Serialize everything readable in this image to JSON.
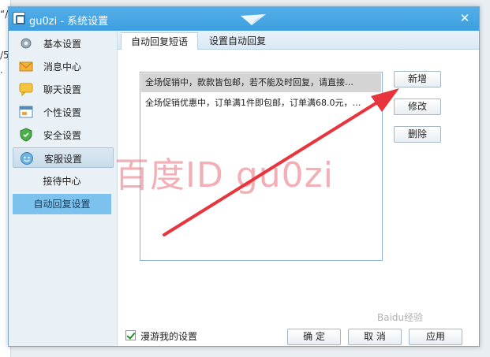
{
  "background": {
    "left_fragments": [
      "“/0",
      "/5",
      "·"
    ]
  },
  "window": {
    "title": "gu0zi - 系统设置",
    "close_glyph": "✕"
  },
  "sidebar": {
    "items": [
      {
        "label": "基本设置",
        "icon": "gear-icon"
      },
      {
        "label": "消息中心",
        "icon": "envelope-icon"
      },
      {
        "label": "聊天设置",
        "icon": "chat-bubble-icon"
      },
      {
        "label": "个性设置",
        "icon": "window-icon"
      },
      {
        "label": "安全设置",
        "icon": "shield-icon"
      },
      {
        "label": "客服设置",
        "icon": "customer-service-icon",
        "expanded": true
      }
    ],
    "sub_items": [
      {
        "label": "接待中心",
        "active": false
      },
      {
        "label": "自动回复设置",
        "active": true
      }
    ]
  },
  "tabs": [
    {
      "label": "自动回复短语",
      "active": true
    },
    {
      "label": "设置自动回复",
      "active": false
    }
  ],
  "phrases": [
    {
      "text": "全场促销中，款款皆包邮，若不能及时回复，请直接…",
      "selected": true
    },
    {
      "text": "全场促销优惠中，订单满1件即包邮，订单满68.0元，…",
      "selected": false
    }
  ],
  "buttons": {
    "add": "新增",
    "edit": "修改",
    "delete": "删除",
    "ok": "确 定",
    "cancel": "取 消",
    "apply": "应用"
  },
  "footer": {
    "roaming_label": "漫游我的设置",
    "roaming_checked": true
  },
  "overlay": {
    "watermark_text": "百度ID gu0zi",
    "corner_text": "Baidu经验",
    "arrow_color": "#e8343c"
  },
  "colors": {
    "titlebar": "#3d9fe0",
    "active_nav": "#7cc2ee",
    "selected_row": "#d4d4d4"
  }
}
